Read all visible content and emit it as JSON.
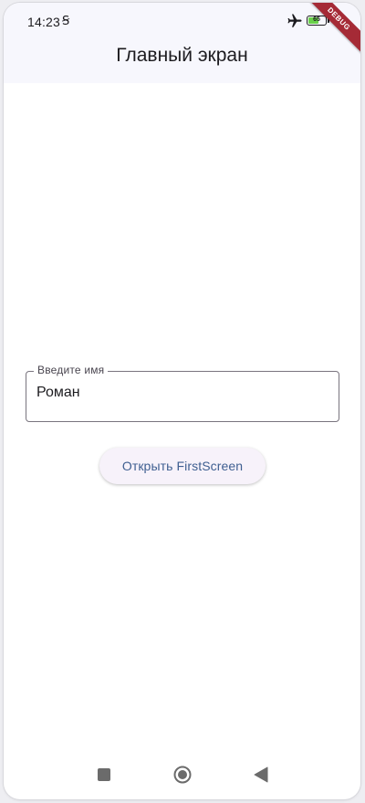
{
  "status_bar": {
    "time": "14:23",
    "sim_icon": "sim-s-icon",
    "battery_level": "65",
    "battery_fraction": 0.65
  },
  "debug_banner": {
    "label": "DEBUG",
    "color": "#a52a36"
  },
  "app_bar": {
    "title": "Главный экран"
  },
  "name_field": {
    "label": "Введите имя",
    "value": "Роман"
  },
  "open_button": {
    "label": "Открыть FirstScreen"
  },
  "navigation_bar": {
    "recents_icon": "square-icon",
    "home_icon": "circle-home-icon",
    "back_icon": "triangle-back-icon"
  },
  "colors": {
    "surface": "#f7f7fd",
    "button_text": "#3f5f91",
    "battery_fill": "#6ad14a"
  }
}
